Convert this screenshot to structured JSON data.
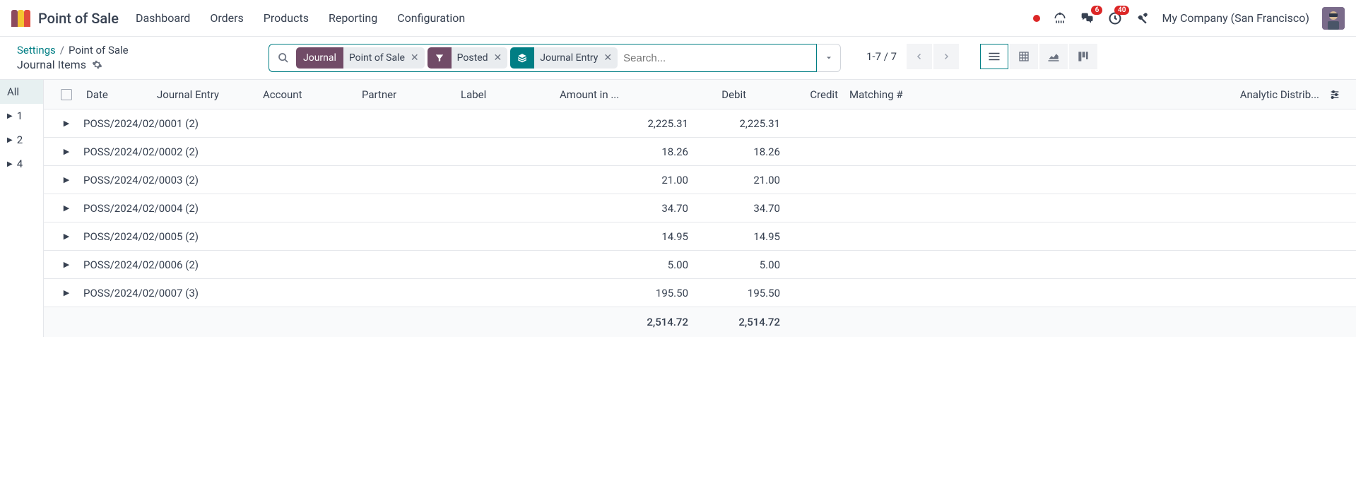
{
  "header": {
    "app_title": "Point of Sale",
    "nav": [
      "Dashboard",
      "Orders",
      "Products",
      "Reporting",
      "Configuration"
    ],
    "badges": {
      "messages": "6",
      "activities": "40"
    },
    "company": "My Company (San Francisco)"
  },
  "breadcrumb": {
    "link1": "Settings",
    "link2": "Point of Sale",
    "subtitle": "Journal Items"
  },
  "search": {
    "chip1_head": "Journal",
    "chip1_body": "Point of Sale",
    "chip2_body": "Posted",
    "chip3_body": "Journal Entry",
    "placeholder": "Search..."
  },
  "pager": {
    "text": "1-7 / 7"
  },
  "sidebar": {
    "all": "All",
    "items": [
      "1",
      "2",
      "4"
    ]
  },
  "columns": {
    "date": "Date",
    "journal_entry": "Journal Entry",
    "account": "Account",
    "partner": "Partner",
    "label": "Label",
    "amount": "Amount in ...",
    "debit": "Debit",
    "credit": "Credit",
    "matching": "Matching #",
    "analytic": "Analytic Distrib..."
  },
  "rows": [
    {
      "label": "POSS/2024/02/0001 (2)",
      "debit": "2,225.31",
      "credit": "2,225.31"
    },
    {
      "label": "POSS/2024/02/0002 (2)",
      "debit": "18.26",
      "credit": "18.26"
    },
    {
      "label": "POSS/2024/02/0003 (2)",
      "debit": "21.00",
      "credit": "21.00"
    },
    {
      "label": "POSS/2024/02/0004 (2)",
      "debit": "34.70",
      "credit": "34.70"
    },
    {
      "label": "POSS/2024/02/0005 (2)",
      "debit": "14.95",
      "credit": "14.95"
    },
    {
      "label": "POSS/2024/02/0006 (2)",
      "debit": "5.00",
      "credit": "5.00"
    },
    {
      "label": "POSS/2024/02/0007 (3)",
      "debit": "195.50",
      "credit": "195.50"
    }
  ],
  "totals": {
    "debit": "2,514.72",
    "credit": "2,514.72"
  }
}
